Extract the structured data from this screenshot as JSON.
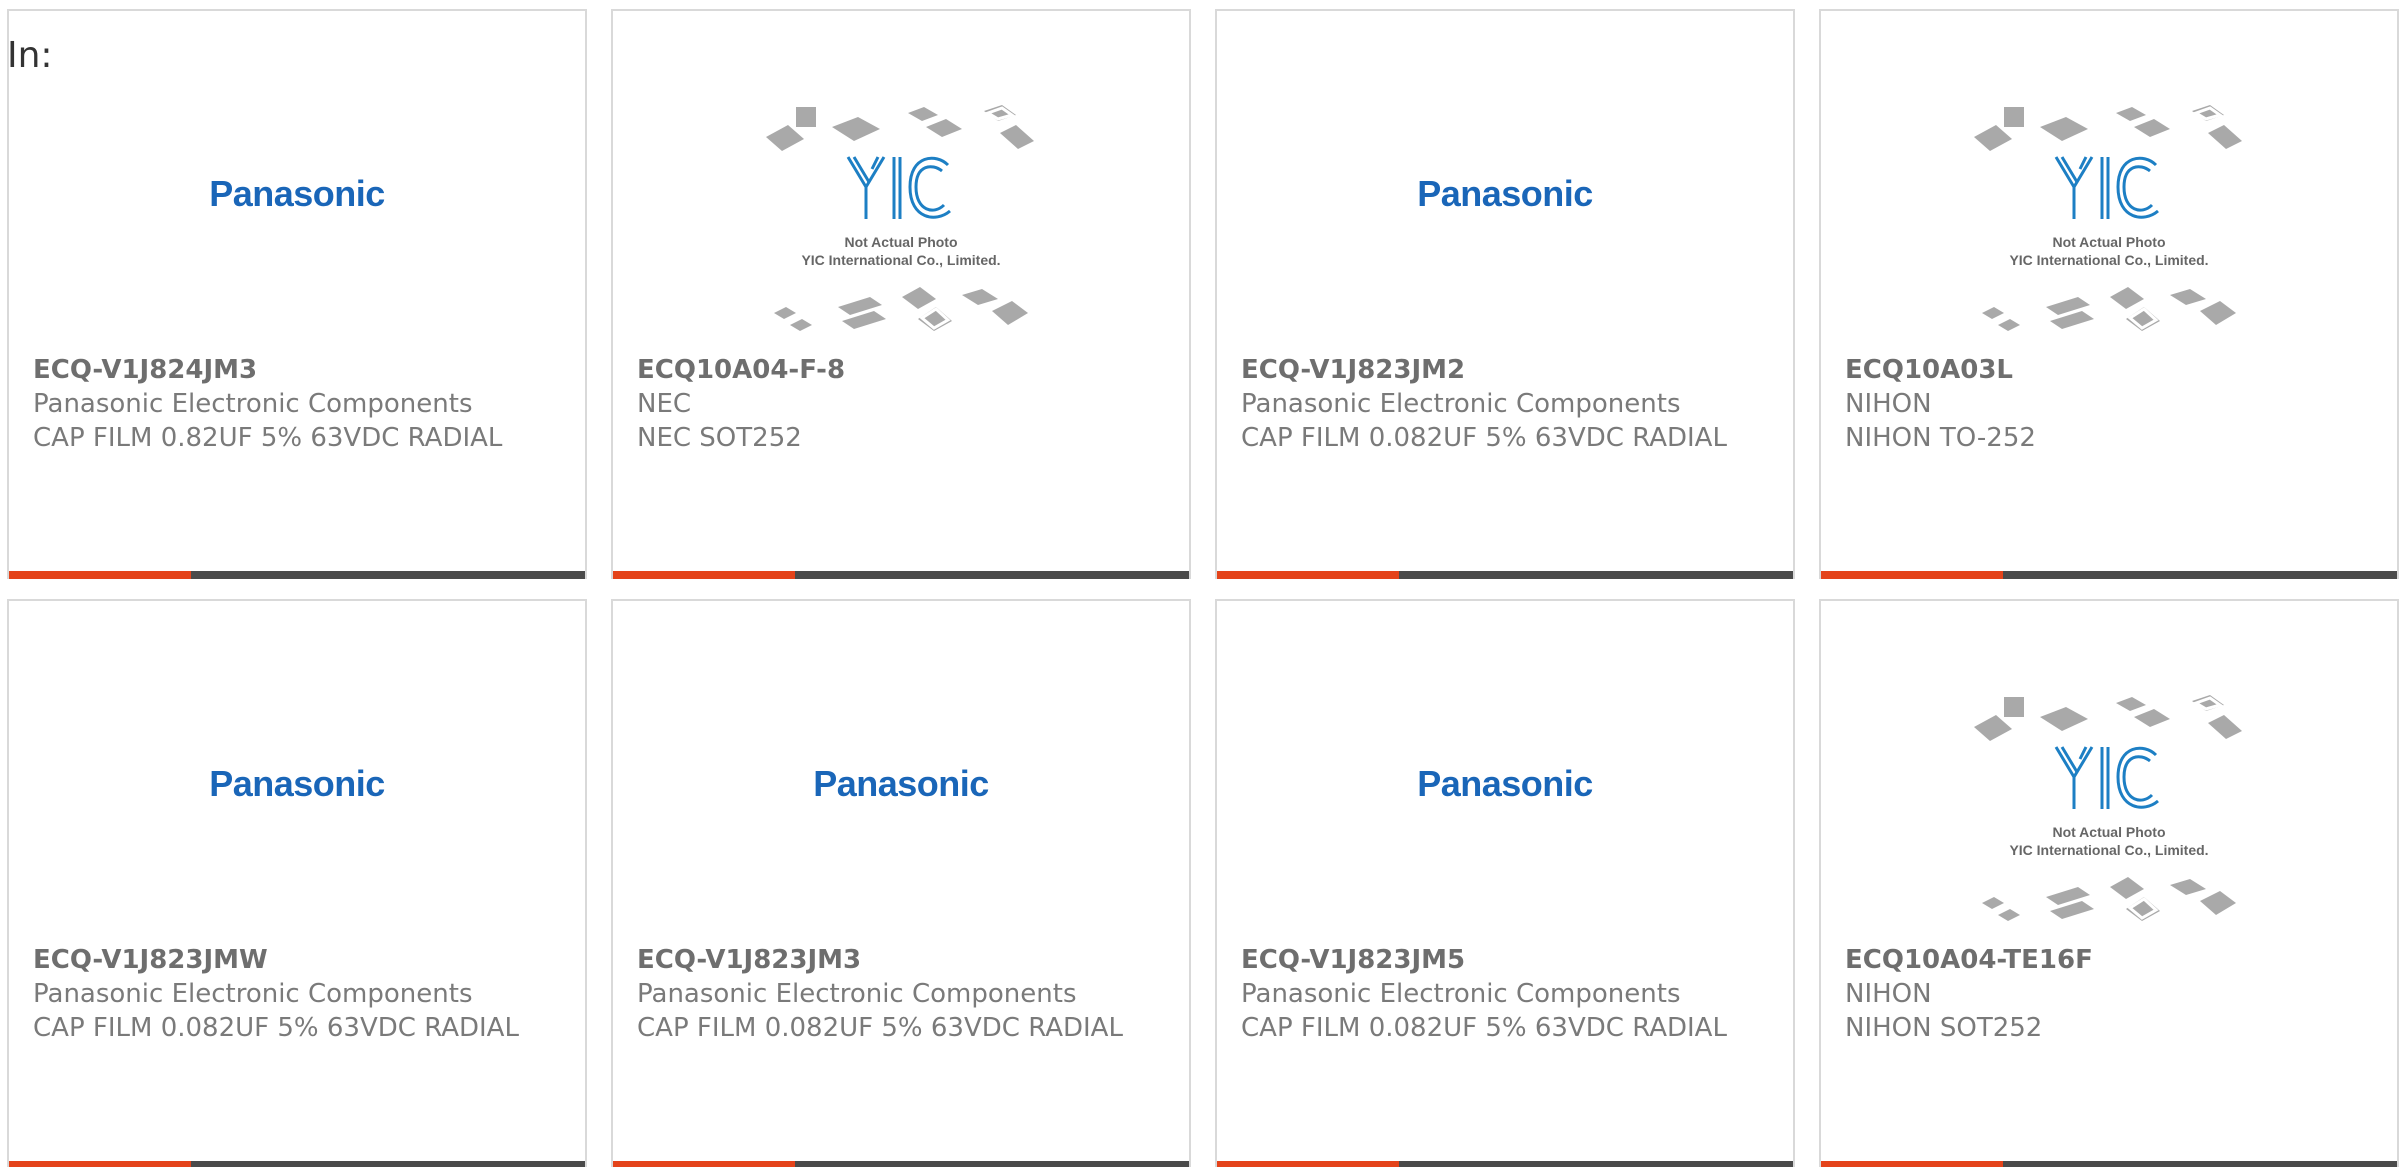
{
  "header": {
    "label": "In:"
  },
  "products": [
    {
      "part": "ECQ-V1J824JM3",
      "maker": "Panasonic Electronic Components",
      "desc": "CAP FILM 0.82UF 5% 63VDC RADIAL",
      "image": "panasonic-logo"
    },
    {
      "part": "ECQ10A04-F-8",
      "maker": "NEC",
      "desc": "NEC SOT252",
      "image": "yic-placeholder"
    },
    {
      "part": "ECQ-V1J823JM2",
      "maker": "Panasonic Electronic Components",
      "desc": "CAP FILM 0.082UF 5% 63VDC RADIAL",
      "image": "panasonic-logo"
    },
    {
      "part": "ECQ10A03L",
      "maker": "NIHON",
      "desc": "NIHON TO-252",
      "image": "yic-placeholder"
    },
    {
      "part": "ECQ-V1J823JMW",
      "maker": "Panasonic Electronic Components",
      "desc": "CAP FILM 0.082UF 5% 63VDC RADIAL",
      "image": "panasonic-logo"
    },
    {
      "part": "ECQ-V1J823JM3",
      "maker": "Panasonic Electronic Components",
      "desc": "CAP FILM 0.082UF 5% 63VDC RADIAL",
      "image": "panasonic-logo"
    },
    {
      "part": "ECQ-V1J823JM5",
      "maker": "Panasonic Electronic Components",
      "desc": "CAP FILM 0.082UF 5% 63VDC RADIAL",
      "image": "panasonic-logo"
    },
    {
      "part": "ECQ10A04-TE16F",
      "maker": "NIHON",
      "desc": "NIHON SOT252",
      "image": "yic-placeholder"
    }
  ],
  "logos": {
    "panasonic": "Panasonic",
    "yic_mark": "YIC",
    "yic_line1": "Not Actual Photo",
    "yic_line2": "YIC International Co., Limited."
  },
  "colors": {
    "accent": "#e4431a",
    "bar": "#4a4a4a",
    "panasonic_blue": "#1a66b8",
    "yic_blue": "#1d7fc4"
  }
}
